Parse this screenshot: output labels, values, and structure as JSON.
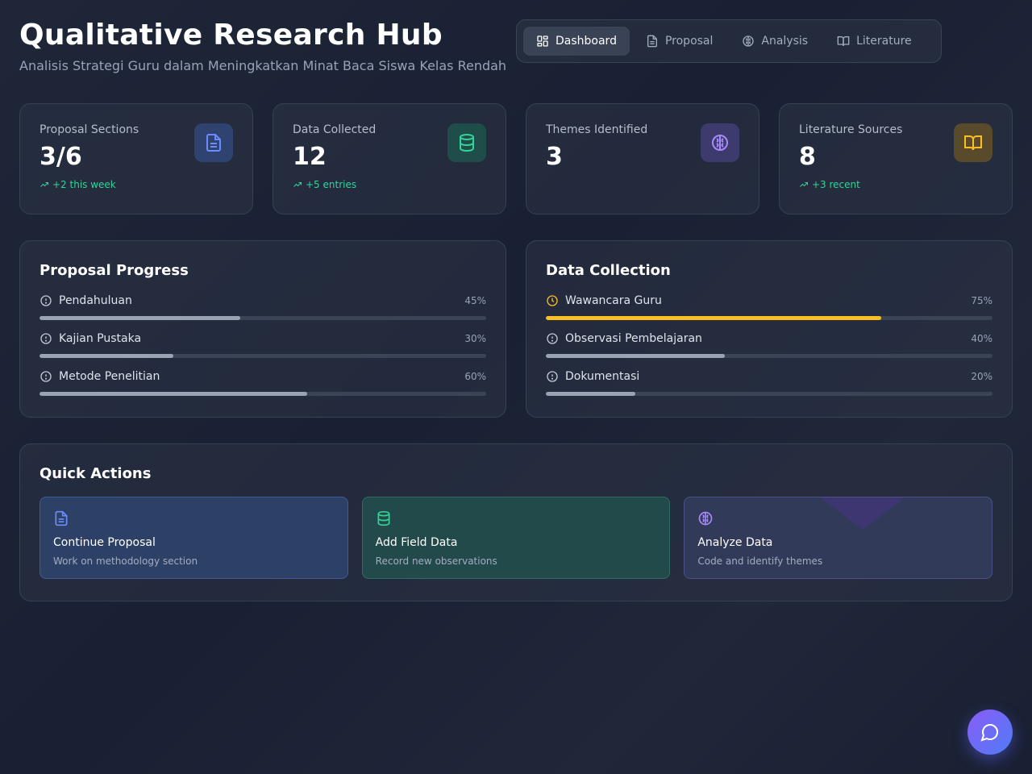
{
  "header": {
    "title": "Qualitative Research Hub",
    "subtitle": "Analisis Strategi Guru dalam Meningkatkan Minat Baca Siswa Kelas Rendah"
  },
  "nav": {
    "tabs": [
      {
        "label": "Dashboard",
        "icon": "grid-icon",
        "active": true
      },
      {
        "label": "Proposal",
        "icon": "document-icon",
        "active": false
      },
      {
        "label": "Analysis",
        "icon": "brain-icon",
        "active": false
      },
      {
        "label": "Literature",
        "icon": "book-open-icon",
        "active": false
      }
    ]
  },
  "stats": [
    {
      "label": "Proposal Sections",
      "value": "3/6",
      "trend": "+2 this week",
      "icon": "document-icon",
      "color": "#6b8cff"
    },
    {
      "label": "Data Collected",
      "value": "12",
      "trend": "+5 entries",
      "icon": "database-icon",
      "color": "#34d399"
    },
    {
      "label": "Themes Identified",
      "value": "3",
      "trend": "",
      "icon": "brain-icon",
      "color": "#a78bfa"
    },
    {
      "label": "Literature Sources",
      "value": "8",
      "trend": "+3 recent",
      "icon": "book-open-icon",
      "color": "#fbbf24"
    }
  ],
  "proposal_progress": {
    "title": "Proposal Progress",
    "items": [
      {
        "label": "Pendahuluan",
        "percent_label": "45%",
        "value": 0.45,
        "icon": "alert-circle-icon"
      },
      {
        "label": "Kajian Pustaka",
        "percent_label": "30%",
        "value": 0.3,
        "icon": "alert-circle-icon"
      },
      {
        "label": "Metode Penelitian",
        "percent_label": "60%",
        "value": 0.6,
        "icon": "alert-circle-icon"
      }
    ]
  },
  "data_collection": {
    "title": "Data Collection",
    "items": [
      {
        "label": "Wawancara Guru",
        "percent_label": "75%",
        "value": 0.75,
        "icon": "clock-icon",
        "color": "#fbbf24"
      },
      {
        "label": "Observasi Pembelajaran",
        "percent_label": "40%",
        "value": 0.4,
        "icon": "alert-circle-icon"
      },
      {
        "label": "Dokumentasi",
        "percent_label": "20%",
        "value": 0.2,
        "icon": "alert-circle-icon"
      }
    ]
  },
  "quick_actions": {
    "title": "Quick Actions",
    "items": [
      {
        "title": "Continue Proposal",
        "desc": "Work on methodology section",
        "icon": "document-icon",
        "color": "#6b8cff"
      },
      {
        "title": "Add Field Data",
        "desc": "Record new observations",
        "icon": "database-icon",
        "color": "#34d399"
      },
      {
        "title": "Analyze Data",
        "desc": "Code and identify themes",
        "icon": "brain-icon",
        "color": "#a78bfa"
      }
    ]
  },
  "chat": {
    "icon": "chat-bubble-icon"
  }
}
